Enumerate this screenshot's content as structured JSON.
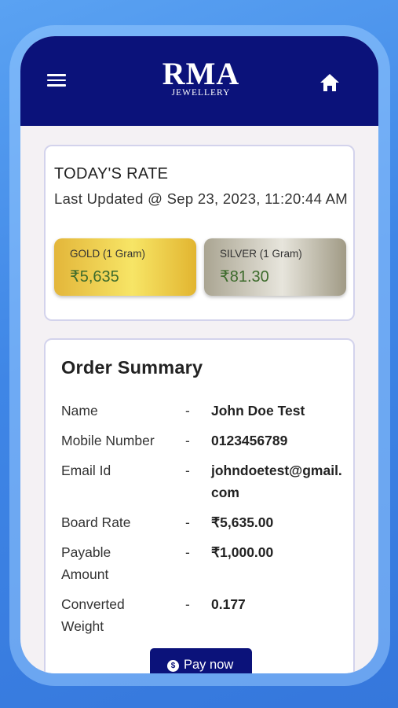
{
  "header": {
    "logo_main": "RMA",
    "logo_sub": "JEWELLERY",
    "menu_icon": "hamburger-menu-icon",
    "home_icon": "home-icon"
  },
  "rate_card": {
    "title": "TODAY'S RATE",
    "last_updated": "Last Updated @ Sep 23, 2023, 11:20:44 AM",
    "gold": {
      "label": "GOLD (1 Gram)",
      "price": "₹5,635"
    },
    "silver": {
      "label": "SILVER (1 Gram)",
      "price": "₹81.30"
    }
  },
  "order_summary": {
    "title": "Order Summary",
    "separator": "-",
    "rows": [
      {
        "label": "Name",
        "value": "John Doe Test"
      },
      {
        "label": "Mobile Number",
        "value": "0123456789"
      },
      {
        "label": "Email Id",
        "value": "johndoetest@gmail.com"
      },
      {
        "label": "Board Rate",
        "value": "₹5,635.00"
      },
      {
        "label": "Payable Amount",
        "value": "₹1,000.00"
      },
      {
        "label": "Converted Weight",
        "value": "0.177"
      }
    ],
    "pay_button": {
      "label": "Pay now",
      "icon": "dollar-coin-icon",
      "icon_glyph": "$"
    }
  },
  "colors": {
    "primary": "#0b127a",
    "background_gradient": "#4a90e8",
    "price_text": "#3d6b2c"
  }
}
